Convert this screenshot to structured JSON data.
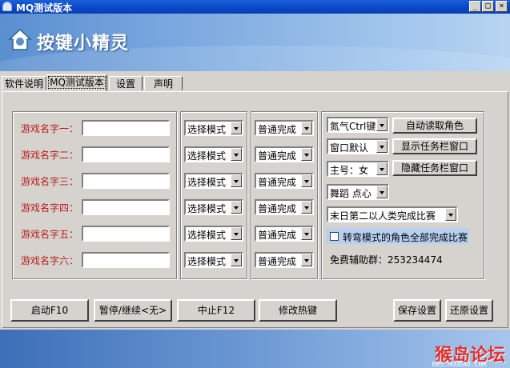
{
  "window": {
    "title": "MQ测试版本",
    "min_label": "_",
    "max_label": "□",
    "close_label": "×"
  },
  "banner": {
    "logo_text": "按键小精灵"
  },
  "tabs": [
    "软件说明",
    "MQ测试版本",
    "设置",
    "声明"
  ],
  "rows": [
    {
      "label": "游戏名字一：",
      "name": "",
      "mode": "选择模式",
      "finish": "普通完成"
    },
    {
      "label": "游戏名字二：",
      "name": "",
      "mode": "选择模式",
      "finish": "普通完成"
    },
    {
      "label": "游戏名字三：",
      "name": "",
      "mode": "选择模式",
      "finish": "普通完成"
    },
    {
      "label": "游戏名字四：",
      "name": "",
      "mode": "选择模式",
      "finish": "普通完成"
    },
    {
      "label": "游戏名字五：",
      "name": "",
      "mode": "选择模式",
      "finish": "普通完成"
    },
    {
      "label": "游戏名字六：",
      "name": "",
      "mode": "选择模式",
      "finish": "普通完成"
    }
  ],
  "right": {
    "key_combo": "氮气Ctrl键",
    "window_combo": "窗口默认",
    "main_combo": "主号：女",
    "dance_combo": "舞蹈 点心",
    "match_combo": "末日第二以人类完成比赛",
    "auto_read_button": "自动读取角色",
    "show_taskbar_button": "显示任务栏窗口",
    "hide_taskbar_button": "隐藏任务栏窗口",
    "checkbox_label": "转弯模式的角色全部完成比赛",
    "checkbox_checked": false,
    "group_text": "免费辅助群：253234474"
  },
  "bottom": {
    "start": "启动F10",
    "pause": "暂停/继续<无>",
    "stop": "中止F12",
    "hotkey": "修改热键",
    "save": "保存设置",
    "restore": "还原设置"
  },
  "watermark": {
    "main": "猴岛论坛",
    "sub": "BBS.HOUDAO.COM"
  }
}
